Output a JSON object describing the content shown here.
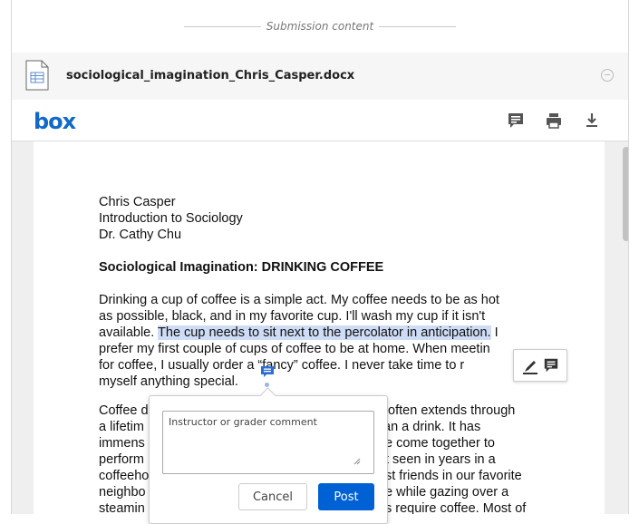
{
  "submission": {
    "header": "Submission content"
  },
  "file": {
    "name": "sociological_imagination_Chris_Casper.docx"
  },
  "toolbar": {
    "brand": "box",
    "icons": [
      "comment-icon",
      "print-icon",
      "download-icon"
    ]
  },
  "document": {
    "author": "Chris Casper",
    "course": "Introduction to Sociology",
    "instructor": "Dr. Cathy Chu",
    "title": "Sociological Imagination: DRINKING COFFEE",
    "p1_lines": [
      "Drinking a cup of coffee is a simple act. My coffee needs to be as hot",
      "as possible, black, and in my favorite cup. I'll wash my cup if it isn't",
      "available. ",
      "The cup needs to sit next to the percolator in anticipation.",
      " I",
      "prefer my first couple of cups of coffee to be at home. When meetin",
      "for coffee, I usually order a “fancy” coffee. I never take time to r",
      "myself anything special."
    ],
    "p2_lines": [
      "Coffee d",
      "t often extends through",
      "a lifetim",
      "an a drink. It has",
      "immens",
      "e come together to",
      "perform",
      "t seen in years in a",
      "coffeeho",
      "st friends in our favorite",
      "neighbo",
      "e while gazing over a",
      "steamin",
      "s require coffee. Most of"
    ]
  },
  "comment_popup": {
    "placeholder": "Instructor or grader comment",
    "cancel_label": "Cancel",
    "post_label": "Post"
  },
  "colors": {
    "accent": "#0061d5",
    "brand": "#1269c9",
    "highlight": "#cfdcf5"
  }
}
